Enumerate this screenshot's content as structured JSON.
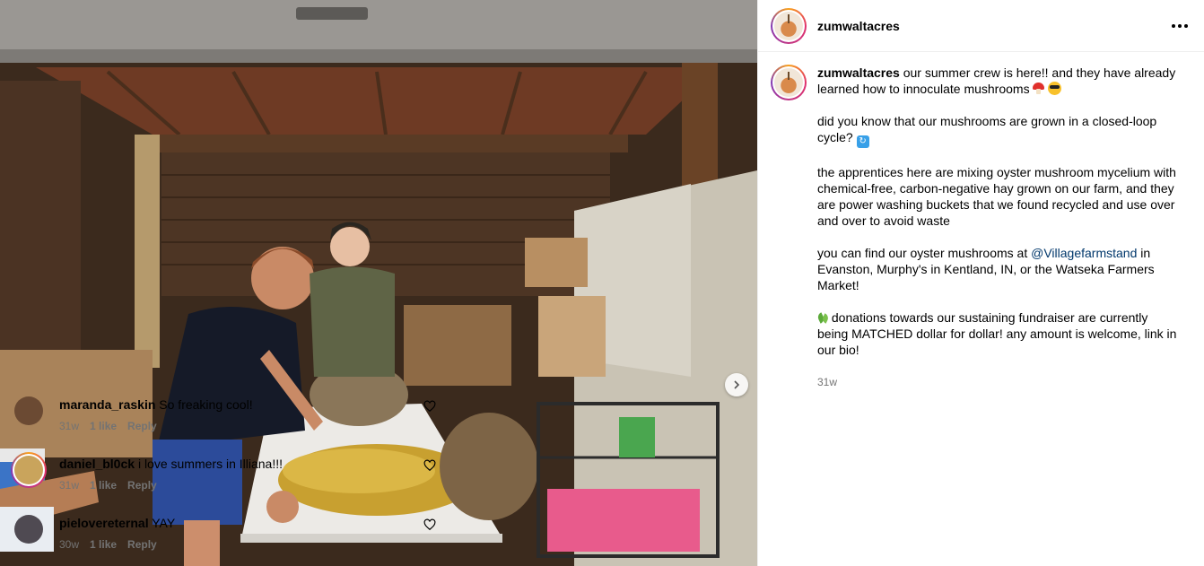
{
  "post": {
    "author": "zumwaltacres",
    "caption": {
      "username": "zumwaltacres",
      "p1": "our summer crew is here!! and they have already learned how to innoculate mushrooms",
      "p2": "did you know that our mushrooms are grown in a closed-loop cycle?",
      "p3": "the apprentices here are mixing oyster mushroom mycelium with chemical-free, carbon-negative hay grown on our farm, and they are power washing buckets that we found recycled and use over and over to avoid waste",
      "p4_pre": "you can find our oyster mushrooms at",
      "p4_mention": "@Villagefarmstand",
      "p4_post": "in Evanston, Murphy's in Kentland, IN, or the Watseka Farmers Market!",
      "p5": "donations towards our sustaining fundraiser are currently being MATCHED dollar for dollar! any amount is welcome, link in our bio!",
      "time": "31w"
    },
    "photo_icons": {
      "next": "chevron-right-icon"
    }
  },
  "comments": [
    {
      "username": "maranda_raskin",
      "text": "So freaking cool!",
      "time": "31w",
      "likes": "1 like",
      "reply": "Reply",
      "avatar_color": "#6b4a33"
    },
    {
      "username": "daniel_bl0ck",
      "text": "i love summers in Illiana!!!",
      "time": "31w",
      "likes": "1 like",
      "reply": "Reply",
      "avatar_color": "#c9a45c"
    },
    {
      "username": "pielovereternal",
      "text": "YAY",
      "time": "30w",
      "likes": "1 like",
      "reply": "Reply",
      "avatar_color": "#4f4a52"
    }
  ],
  "colors": {
    "mention": "#00376b",
    "meta": "#737373"
  }
}
